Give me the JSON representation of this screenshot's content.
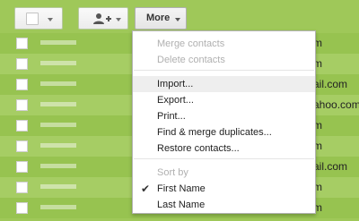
{
  "toolbar": {
    "select_icon": "checkbox-icon",
    "add_contact_icon": "person-add-icon",
    "more_label": "More"
  },
  "menu": {
    "items": [
      {
        "label": "Merge contacts",
        "enabled": false
      },
      {
        "label": "Delete contacts",
        "enabled": false
      },
      {
        "label": "Import...",
        "enabled": true,
        "highlighted": true
      },
      {
        "label": "Export...",
        "enabled": true
      },
      {
        "label": "Print...",
        "enabled": true
      },
      {
        "label": "Find & merge duplicates...",
        "enabled": true
      },
      {
        "label": "Restore contacts...",
        "enabled": true
      },
      {
        "label": "Sort by",
        "enabled": false,
        "header": true
      },
      {
        "label": "First Name",
        "enabled": true,
        "checked": true
      },
      {
        "label": "Last Name",
        "enabled": true
      }
    ]
  },
  "contacts": [
    {
      "email_partial": "m"
    },
    {
      "email_partial": "m"
    },
    {
      "email_partial": "ail.com"
    },
    {
      "email_partial": "ahoo.com"
    },
    {
      "email_partial": "m"
    },
    {
      "email_partial": "m"
    },
    {
      "email_partial": "ail.com"
    },
    {
      "email_partial": "m"
    },
    {
      "email_partial": "m"
    }
  ],
  "colors": {
    "row_green": "#97c350",
    "row_green_alt": "#a6cd64",
    "accent": "#9fc859"
  }
}
